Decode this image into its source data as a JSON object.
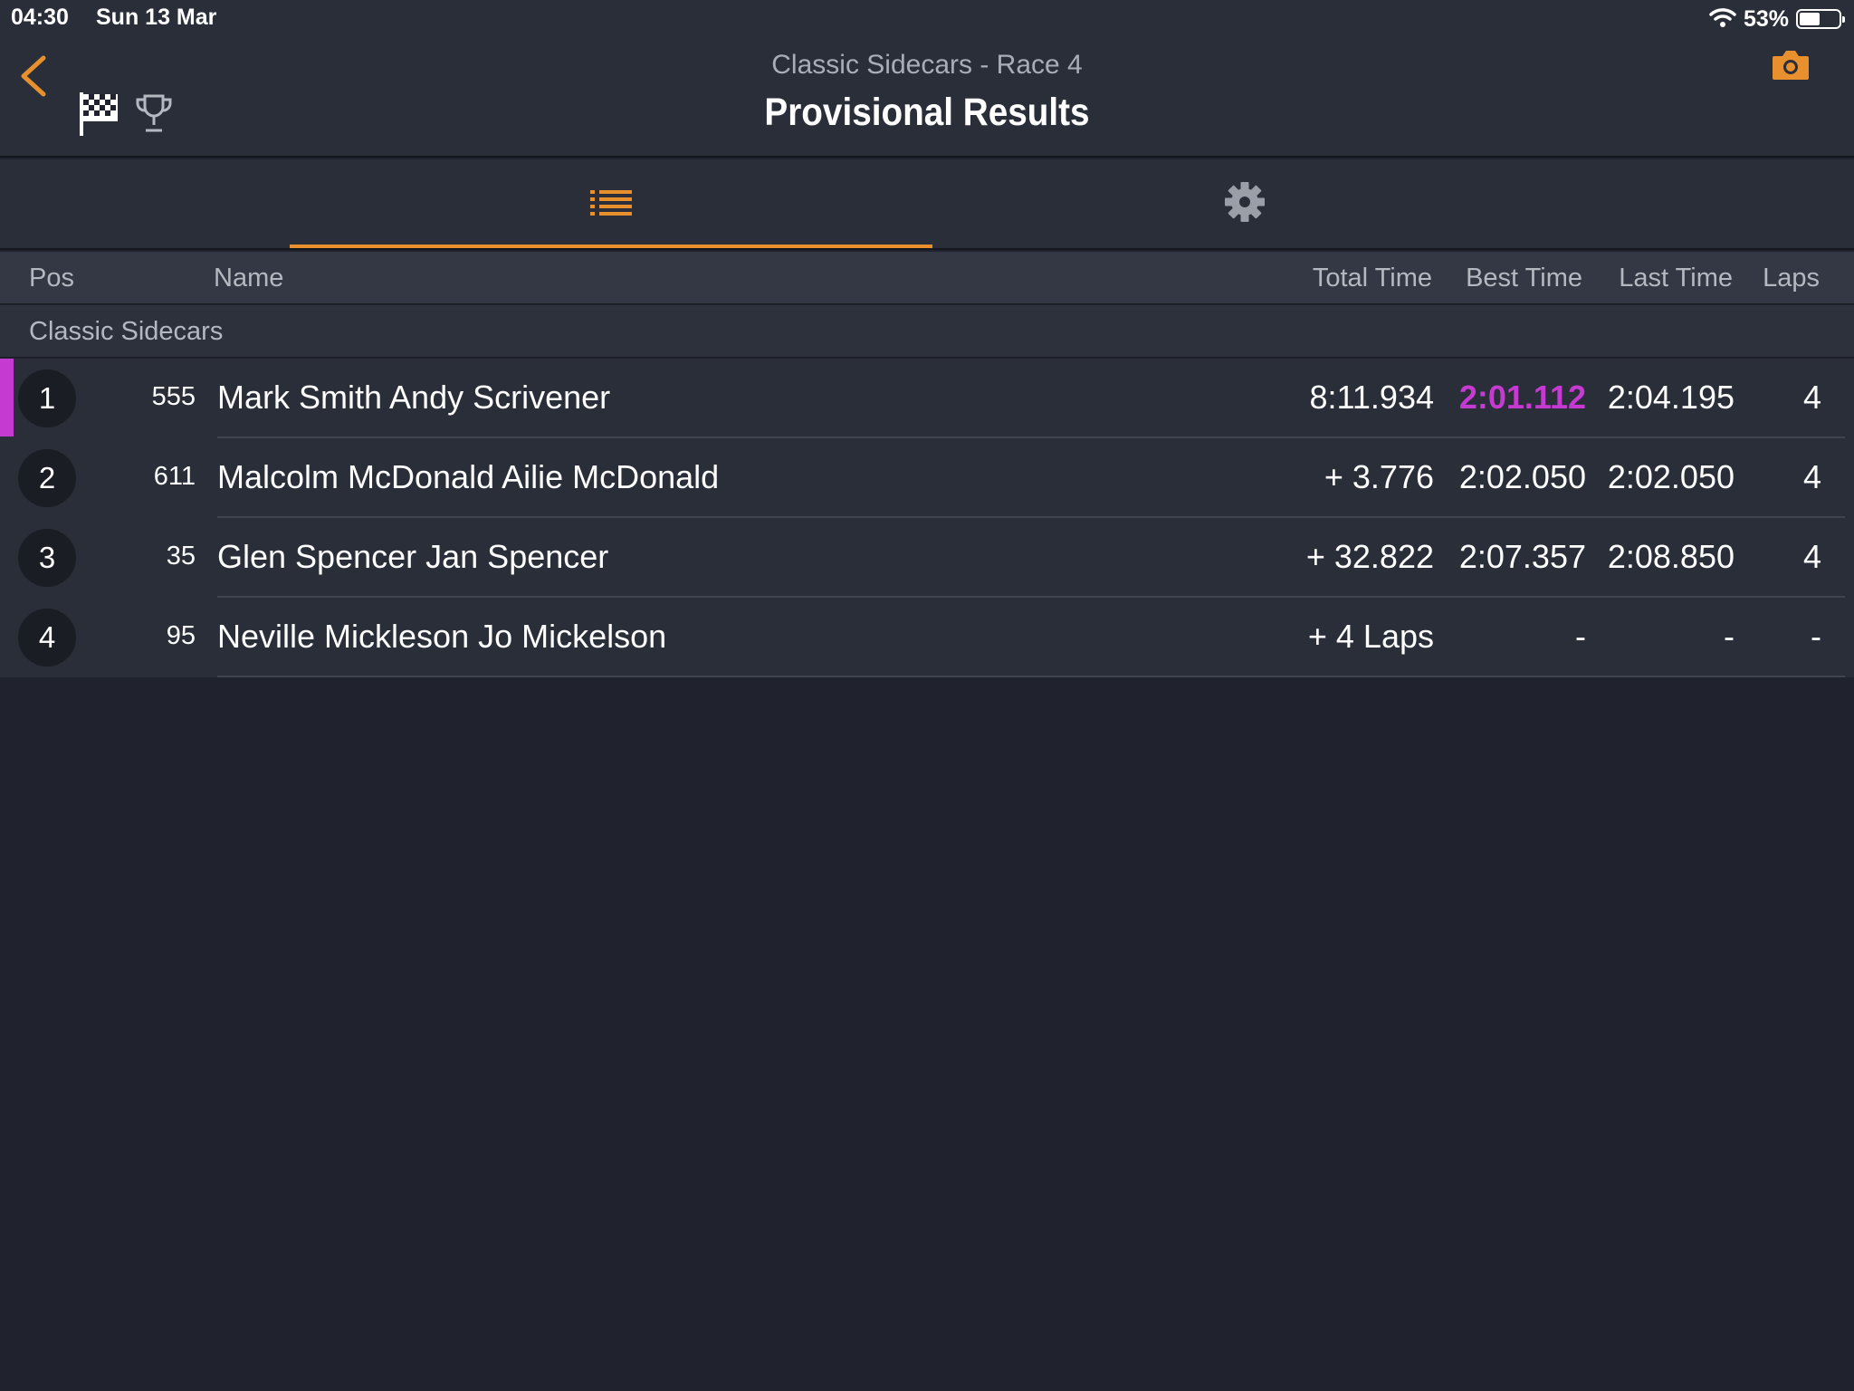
{
  "status_bar": {
    "time": "04:30",
    "date": "Sun 13 Mar",
    "battery": "53%",
    "battery_level": 0.53
  },
  "header": {
    "subtitle": "Classic Sidecars - Race 4",
    "title": "Provisional Results"
  },
  "colors": {
    "accent": "#e8902e",
    "fastest_lap": "#c53ad1",
    "background": "#20232d"
  },
  "icons": {
    "back": "chevron-left-icon",
    "flag": "checkered-flag-icon",
    "trophy": "trophy-icon",
    "camera": "camera-icon",
    "list": "list-icon",
    "settings": "gear-icon",
    "wifi": "wifi-icon",
    "battery": "battery-icon"
  },
  "columns": {
    "pos": "Pos",
    "name": "Name",
    "total_time": "Total Time",
    "best_time": "Best Time",
    "last_time": "Last Time",
    "laps": "Laps"
  },
  "group": {
    "label": "Classic Sidecars"
  },
  "rows": [
    {
      "pos": "1",
      "number": "555",
      "name": "Mark Smith Andy Scrivener",
      "total_time": "8:11.934",
      "best_time": "2:01.112",
      "last_time": "2:04.195",
      "laps": "4",
      "fastest_lap": true
    },
    {
      "pos": "2",
      "number": "611",
      "name": "Malcolm McDonald Ailie McDonald",
      "total_time": "+ 3.776",
      "best_time": "2:02.050",
      "last_time": "2:02.050",
      "laps": "4",
      "fastest_lap": false
    },
    {
      "pos": "3",
      "number": "35",
      "name": "Glen Spencer Jan Spencer",
      "total_time": "+ 32.822",
      "best_time": "2:07.357",
      "last_time": "2:08.850",
      "laps": "4",
      "fastest_lap": false
    },
    {
      "pos": "4",
      "number": "95",
      "name": "Neville Mickleson Jo Mickelson",
      "total_time": "+ 4 Laps",
      "best_time": "-",
      "last_time": "-",
      "laps": "-",
      "fastest_lap": false
    }
  ]
}
